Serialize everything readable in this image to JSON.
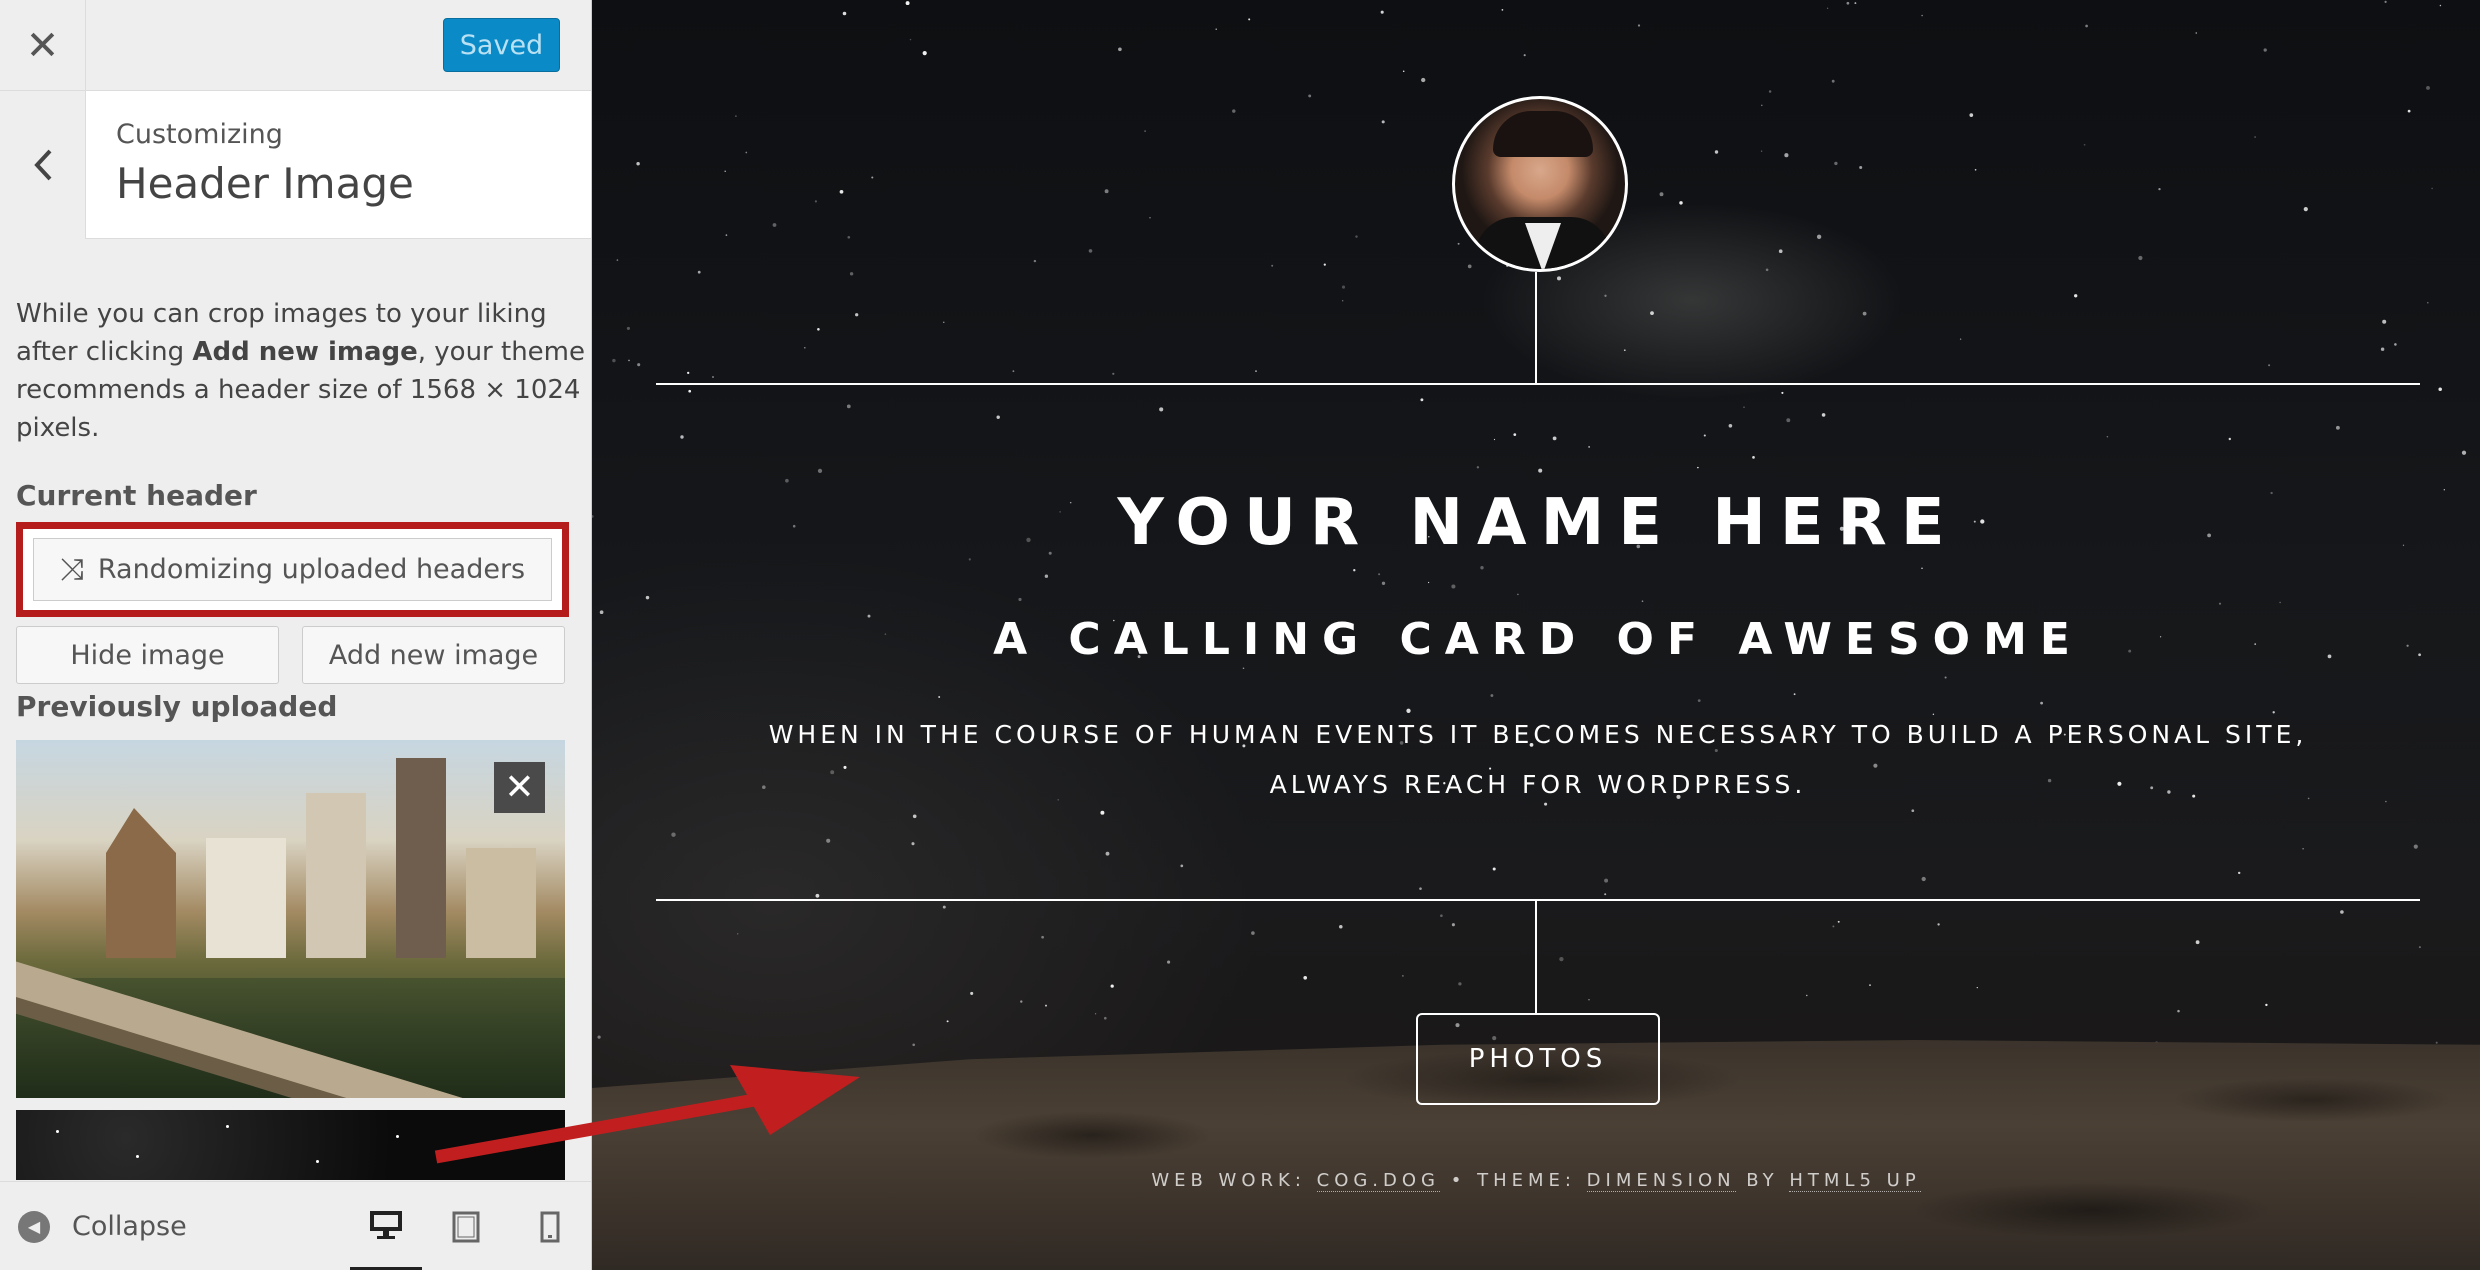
{
  "colors": {
    "accent_blue": "#0a8ac7",
    "highlight_red": "#b51c1c",
    "arrow_red": "#c11f1f"
  },
  "customizer": {
    "close_icon": "close-icon",
    "saved_label": "Saved",
    "back_icon": "chevron-left-icon",
    "customizing_label": "Customizing",
    "section_title": "Header Image",
    "description": {
      "before": "While you can crop images to your liking after clicking ",
      "bold": "Add new image",
      "after": ", your theme recommends a header size of 1568 × 1024 pixels."
    },
    "current_header_label": "Current header",
    "randomize_icon": "shuffle-icon",
    "randomize_label": "Randomizing uploaded headers",
    "hide_image_label": "Hide image",
    "add_new_image_label": "Add new image",
    "previously_uploaded_label": "Previously uploaded",
    "remove_icon": "close-icon",
    "collapse_label": "Collapse",
    "devices": [
      "desktop-icon",
      "tablet-icon",
      "mobile-icon"
    ]
  },
  "site": {
    "name": "YOUR NAME HERE",
    "tagline": "A CALLING CARD OF AWESOME",
    "description": "WHEN IN THE COURSE OF HUMAN EVENTS IT BECOMES NECESSARY TO BUILD A PERSONAL SITE, ALWAYS REACH FOR WORDPRESS.",
    "nav_button": "PHOTOS",
    "footer": {
      "prefix": "WEB WORK: ",
      "link1": "COG.DOG",
      "middle": " • THEME: ",
      "link2": "DIMENSION",
      "by": " BY ",
      "link3": "HTML5 UP"
    }
  }
}
